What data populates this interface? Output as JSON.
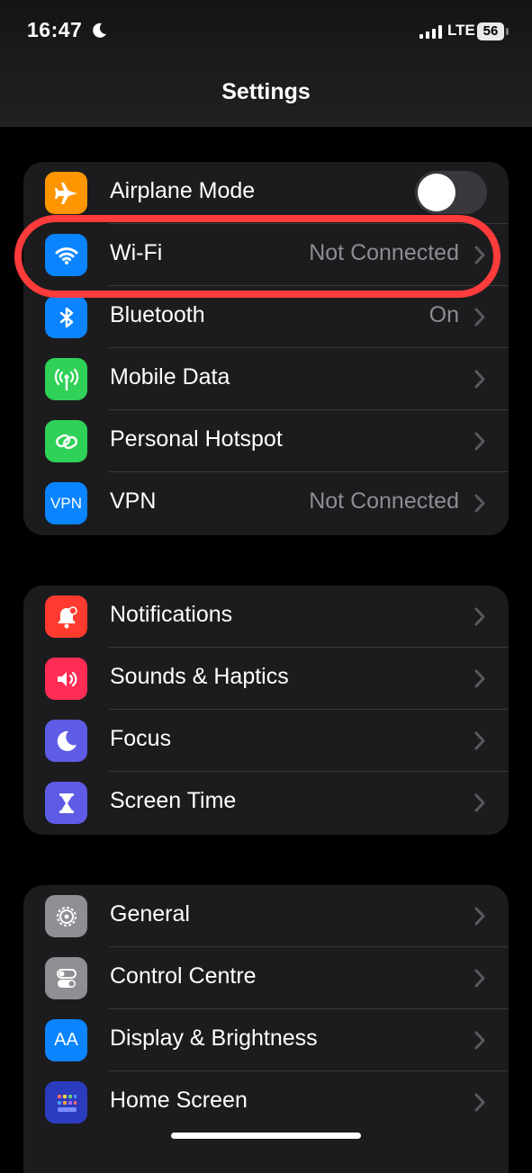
{
  "status_bar": {
    "time": "16:47",
    "network": "LTE",
    "battery": "56"
  },
  "header": {
    "title": "Settings"
  },
  "groups": [
    {
      "items": [
        {
          "label": "Airplane Mode",
          "icon": "airplane-icon",
          "color": "#ff9500",
          "toggle": false
        },
        {
          "label": "Wi-Fi",
          "value": "Not Connected",
          "icon": "wifi-icon",
          "color": "#0a84ff"
        },
        {
          "label": "Bluetooth",
          "value": "On",
          "icon": "bluetooth-icon",
          "color": "#0a84ff"
        },
        {
          "label": "Mobile Data",
          "icon": "antenna-icon",
          "color": "#30d158"
        },
        {
          "label": "Personal Hotspot",
          "icon": "link-icon",
          "color": "#30d158"
        },
        {
          "label": "VPN",
          "value": "Not Connected",
          "icon": "vpn-icon",
          "icon_text": "VPN",
          "color": "#0a84ff"
        }
      ]
    },
    {
      "items": [
        {
          "label": "Notifications",
          "icon": "bell-icon",
          "color": "#ff3b30"
        },
        {
          "label": "Sounds & Haptics",
          "icon": "speaker-icon",
          "color": "#ff2d55"
        },
        {
          "label": "Focus",
          "icon": "moon-icon",
          "color": "#5e5ce6"
        },
        {
          "label": "Screen Time",
          "icon": "hourglass-icon",
          "color": "#5e5ce6"
        }
      ]
    },
    {
      "items": [
        {
          "label": "General",
          "icon": "gear-icon",
          "color": "#8e8e93"
        },
        {
          "label": "Control Centre",
          "icon": "switches-icon",
          "color": "#8e8e93"
        },
        {
          "label": "Display & Brightness",
          "icon": "text-size-icon",
          "icon_text": "AA",
          "color": "#0a84ff"
        },
        {
          "label": "Home Screen",
          "icon": "home-grid-icon",
          "color": "#2c3cbe"
        }
      ]
    }
  ],
  "highlight_color": "#ff3b3b"
}
